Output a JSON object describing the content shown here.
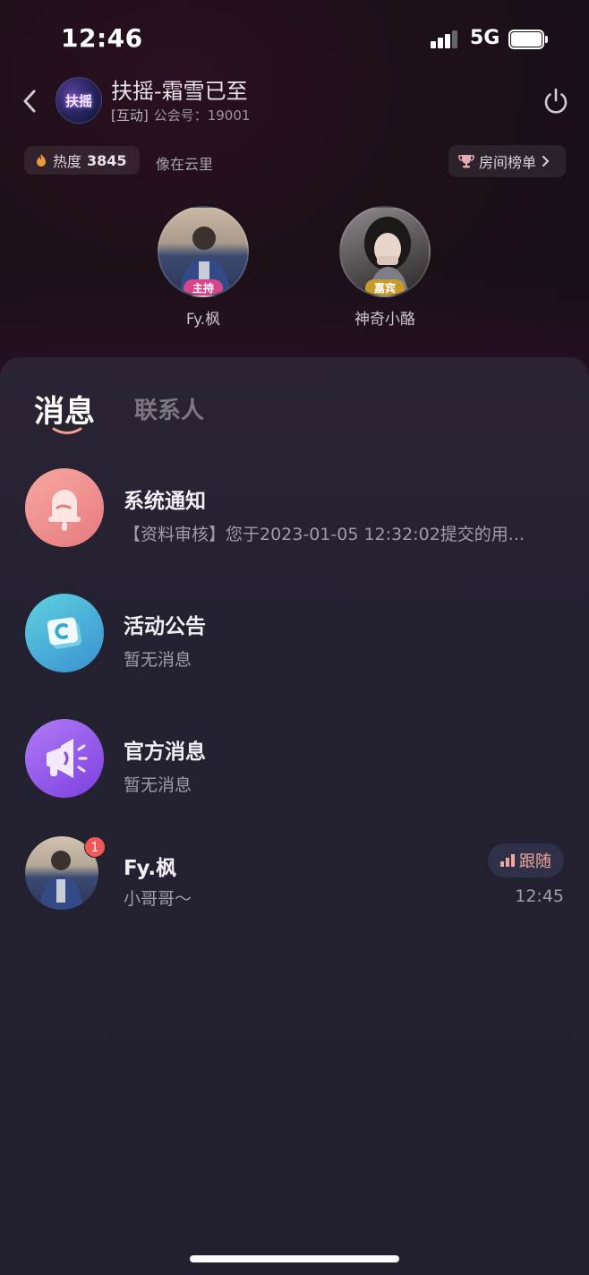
{
  "status_bar": {
    "time": "12:46",
    "network": "5G"
  },
  "room": {
    "avatar_text": "扶摇",
    "title": "扶摇-霜雪已至",
    "tag": "[互动]",
    "guild_id": "公会号：19001",
    "heat_label": "热度",
    "heat_value": "3845",
    "slogan": "像在云里",
    "rank_label": "房间榜单",
    "back_icon": "chevron-left-icon",
    "power_icon": "power-icon"
  },
  "seats": [
    {
      "name": "Fy.枫",
      "role": "主持",
      "role_color": "#d9448a"
    },
    {
      "name": "神奇小酪",
      "role": "嘉宾",
      "role_color": "#c79a2a"
    }
  ],
  "tabs": {
    "active": "消息",
    "inactive": "联系人"
  },
  "messages": [
    {
      "title": "系统通知",
      "subtitle": "【资料审核】您于2023-01-05 12:32:02提交的用...",
      "icon": "bell-icon"
    },
    {
      "title": "活动公告",
      "subtitle": "暂无消息",
      "icon": "activity-card-icon"
    },
    {
      "title": "官方消息",
      "subtitle": "暂无消息",
      "icon": "megaphone-icon"
    },
    {
      "title": "Fy.枫",
      "subtitle": "小哥哥～",
      "badge": "1",
      "follow_label": "跟随",
      "time": "12:45"
    }
  ],
  "colors": {
    "system_icon": "#f08f8f",
    "activity_icon": "#3cb4d6",
    "official_icon": "#9a5cf0",
    "badge": "#f25757",
    "follow_text": "#f1a6a0"
  }
}
